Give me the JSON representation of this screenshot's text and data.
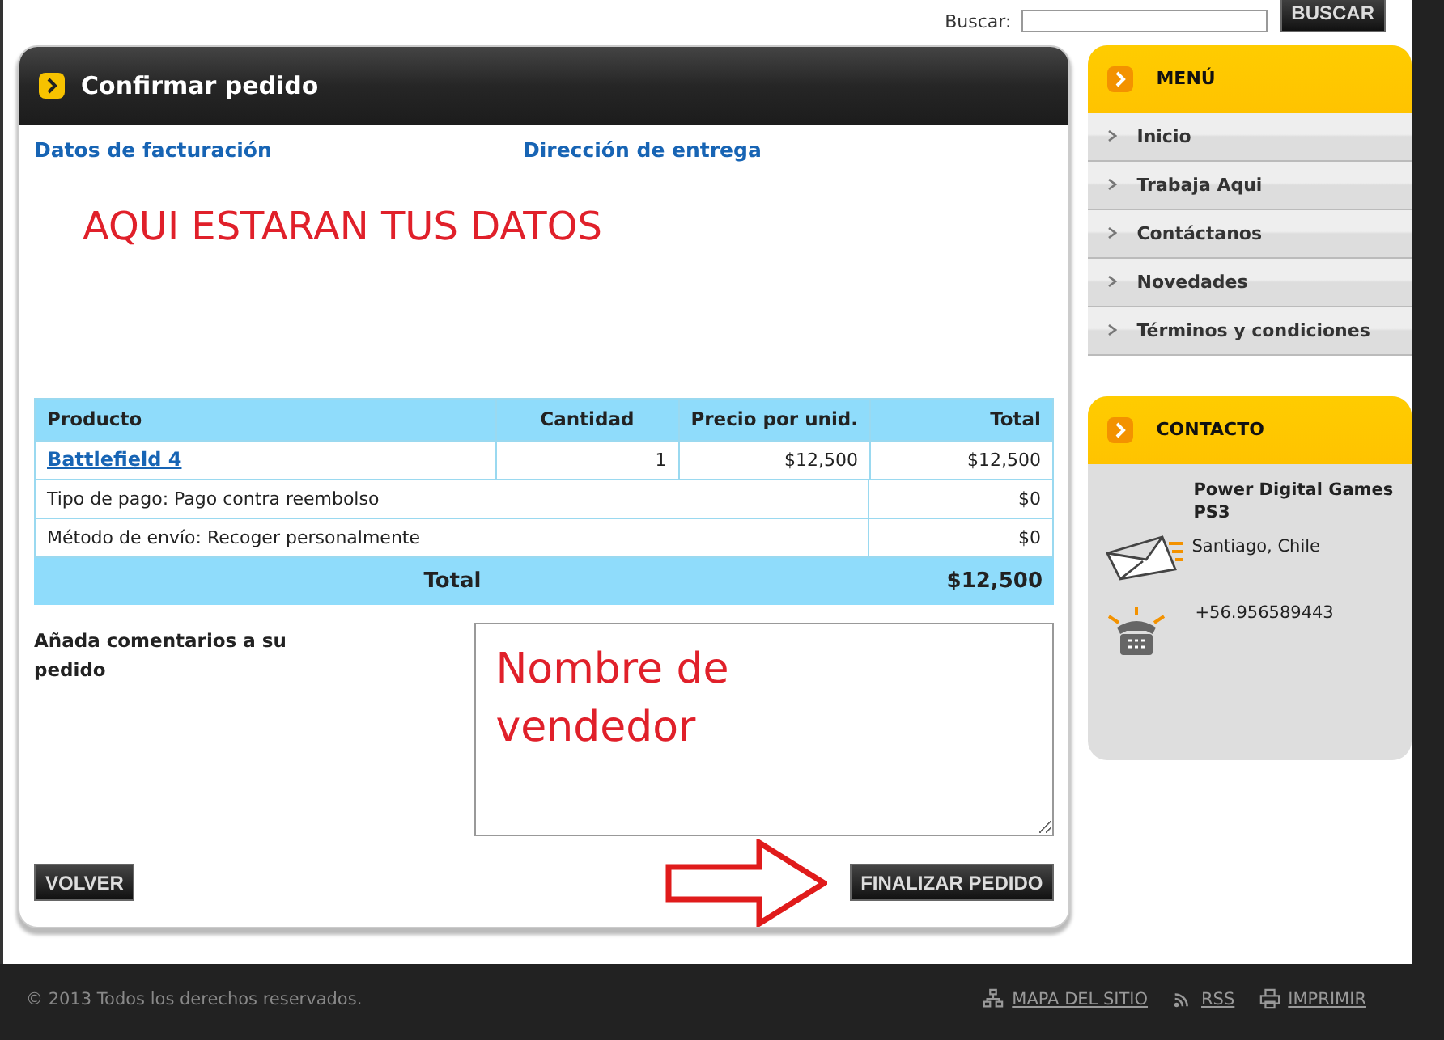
{
  "search": {
    "label": "Buscar:",
    "button": "BUSCAR"
  },
  "panel": {
    "title": "Confirmar pedido",
    "billing_heading": "Datos de facturación",
    "shipping_heading": "Dirección de entrega",
    "data_note": "AQUI ESTARAN TUS DATOS"
  },
  "table": {
    "columns": [
      "Producto",
      "Cantidad",
      "Precio por unid.",
      "Total"
    ],
    "rows": [
      {
        "cells": [
          "Battlefield 4",
          "1",
          "$12,500",
          "$12,500"
        ]
      }
    ]
  },
  "charges": [
    {
      "label": "Tipo de pago: Pago contra reembolso",
      "amount": "$0"
    },
    {
      "label": "Método de envío: Recoger personalmente",
      "amount": "$0"
    }
  ],
  "order_total": {
    "label": "Total",
    "value": "$12,500"
  },
  "comments": {
    "label": "Añada comentarios a su pedido",
    "value": "Nombre de vendedor"
  },
  "buttons": [
    {
      "kind": "back",
      "label": "VOLVER"
    },
    {
      "kind": "submit",
      "label": "FINALIZAR PEDIDO"
    }
  ],
  "sidebar": {
    "menu_title": "MENÚ",
    "items": [
      "Inicio",
      "Trabaja Aqui",
      "Contáctanos",
      "Novedades",
      "Términos y condiciones"
    ],
    "contact_title": "CONTACTO",
    "company": "Power Digital Games PS3",
    "address": "Santiago, Chile",
    "phone": "+56.956589443"
  },
  "footer": {
    "copyright": "© 2013 Todos los derechos reservados.",
    "links": [
      {
        "kind": "sitemap",
        "label": "MAPA DEL SITIO"
      },
      {
        "kind": "rss",
        "label": "RSS"
      },
      {
        "kind": "print",
        "label": "IMPRIMIR"
      }
    ]
  }
}
